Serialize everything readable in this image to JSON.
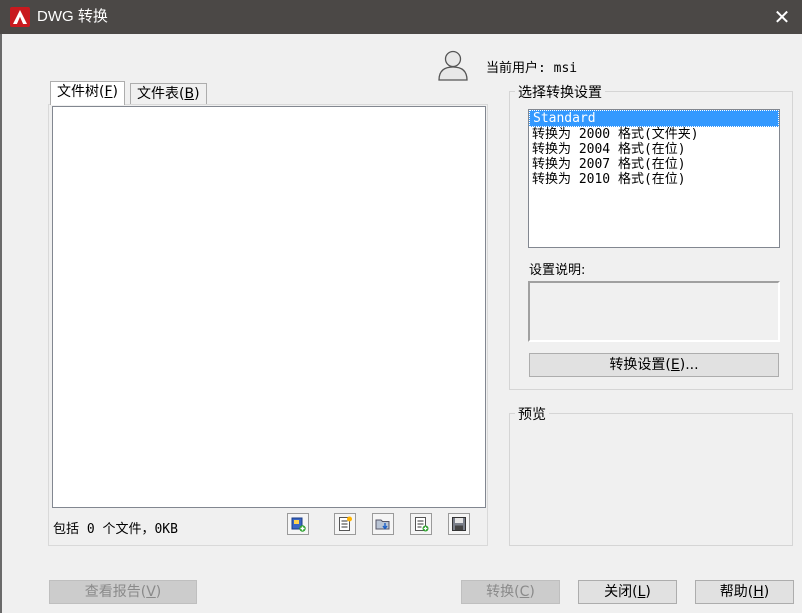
{
  "window": {
    "title": "DWG 转换",
    "close_glyph": "✕",
    "icon": "autocad-logo-icon"
  },
  "user": {
    "label": "当前用户: msi",
    "icon": "user-silhouette-icon"
  },
  "tabs": [
    {
      "label": "文件树",
      "mnemonic": "F",
      "active": true
    },
    {
      "label": "文件表",
      "mnemonic": "B",
      "active": false
    }
  ],
  "file_tree": {
    "status": "包括 0 个文件，0KB",
    "toolbar": [
      {
        "icon": "add-file-icon"
      },
      {
        "icon": "append-list-icon"
      },
      {
        "icon": "open-folder-icon"
      },
      {
        "icon": "new-list-icon"
      },
      {
        "icon": "save-icon"
      }
    ]
  },
  "convert_settings": {
    "group_label": "选择转换设置",
    "items": [
      {
        "label": "Standard",
        "selected": true
      },
      {
        "label": "转换为 2000 格式(文件夹)",
        "selected": false
      },
      {
        "label": "转换为 2004 格式(在位)",
        "selected": false
      },
      {
        "label": "转换为 2007 格式(在位)",
        "selected": false
      },
      {
        "label": "转换为 2010 格式(在位)",
        "selected": false
      }
    ],
    "description_label": "设置说明:",
    "description_text": "",
    "settings_button": {
      "text": "转换设置",
      "mnemonic": "E",
      "suffix": "..."
    }
  },
  "preview": {
    "group_label": "预览"
  },
  "footer": {
    "view_report": {
      "text": "查看报告",
      "mnemonic": "V",
      "enabled": false
    },
    "convert": {
      "text": "转换",
      "mnemonic": "C",
      "enabled": false
    },
    "close": {
      "text": "关闭",
      "mnemonic": "L",
      "enabled": true
    },
    "help": {
      "text": "帮助",
      "mnemonic": "H",
      "enabled": true
    }
  },
  "colors": {
    "titlebar": "#4b4846",
    "selection": "#3399ff",
    "dialog_bg": "#f0f0f0"
  }
}
